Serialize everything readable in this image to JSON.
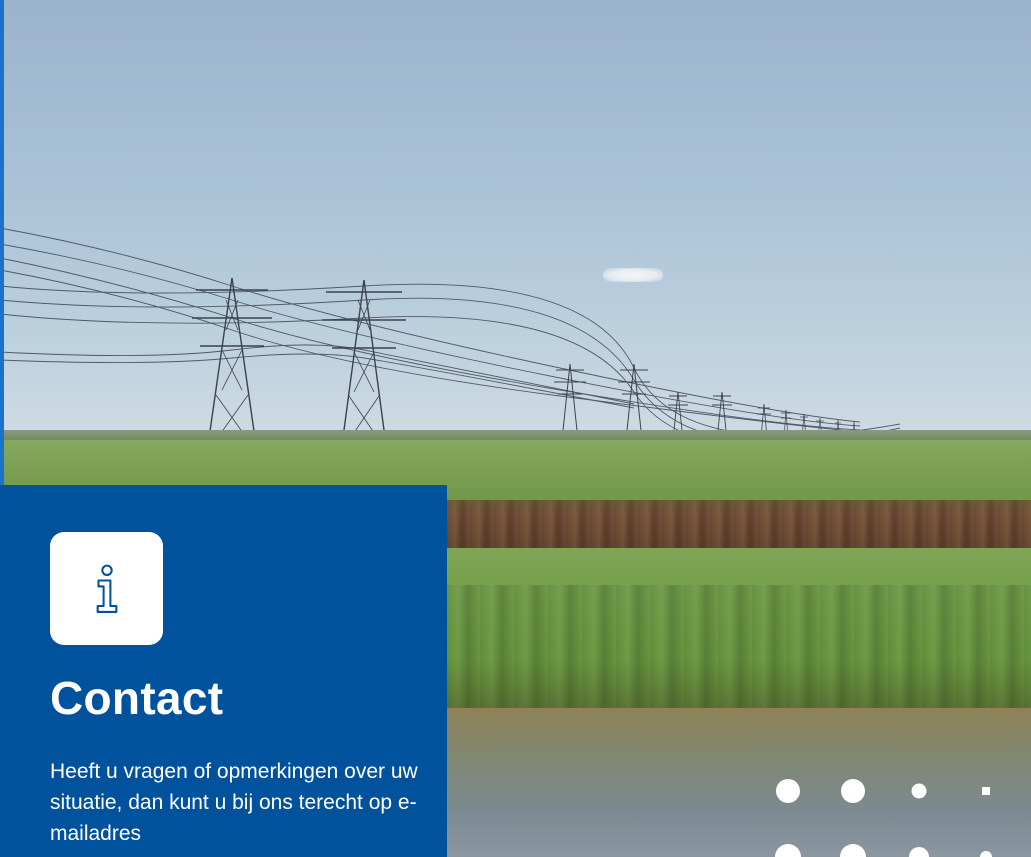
{
  "contact": {
    "icon": "info-icon",
    "title": "Contact",
    "body": "Heeft u vragen of opmerkingen over uw situatie, dan kunt u bij ons terecht op e-mailadres"
  },
  "colors": {
    "panel_blue": "#00529c",
    "accent_blue": "#1a73c8",
    "icon_stroke": "#00529c",
    "text": "#ffffff"
  }
}
